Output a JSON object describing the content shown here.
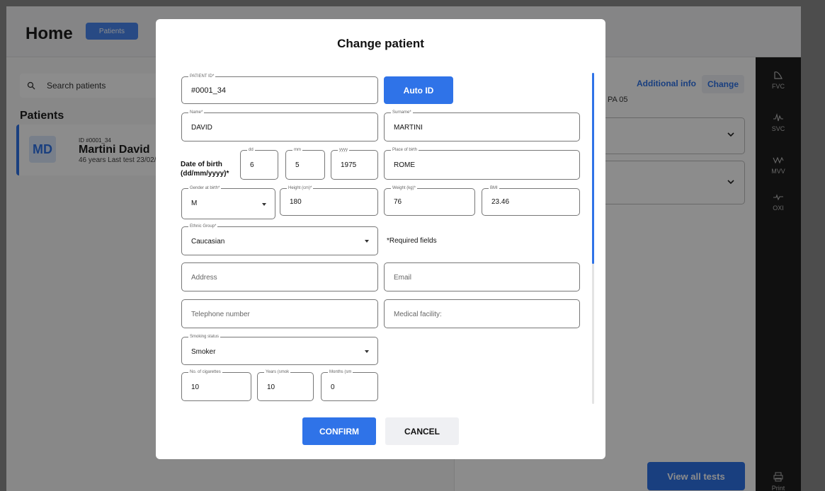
{
  "header": {
    "title": "Home",
    "tab_label": "Patients"
  },
  "sidebar": {
    "search_placeholder": "Search patients",
    "section_title": "Patients",
    "patient": {
      "initials": "MD",
      "id": "ID #0001_34",
      "name": "Martini David",
      "meta": "46 years Last test 23/02/"
    }
  },
  "right_panel": {
    "additional_info": "Additional info",
    "change_label": "Change",
    "pa_value": "PA 05",
    "view_all_label": "View all tests"
  },
  "rail": {
    "items": [
      "FVC",
      "SVC",
      "MVV",
      "OXI",
      "Print"
    ]
  },
  "modal": {
    "title": "Change patient",
    "patient_id": {
      "label": "PATIENT ID*",
      "value": "#0001_34"
    },
    "auto_id_label": "Auto ID",
    "name": {
      "label": "Name*",
      "value": "DAVID"
    },
    "surname": {
      "label": "Surname*",
      "value": "MARTINI"
    },
    "dob_label": "Date of birth (dd/mm/yyyy)*",
    "dd": {
      "label": "dd",
      "value": "6"
    },
    "mm": {
      "label": "mm",
      "value": "5"
    },
    "yyyy": {
      "label": "yyyy",
      "value": "1975"
    },
    "place_of_birth": {
      "label": "Place of birth",
      "value": "ROME"
    },
    "gender": {
      "label": "Gender at birth*",
      "value": "M"
    },
    "height": {
      "label": "Height (cm)*",
      "value": "180"
    },
    "weight": {
      "label": "Weight (kg)*",
      "value": "76"
    },
    "bmi": {
      "label": "BMI",
      "value": "23.46"
    },
    "ethnic_group": {
      "label": "Ethnic Group*",
      "value": "Caucasian"
    },
    "required_note": "*Required fields",
    "address_placeholder": "Address",
    "email_placeholder": "Email",
    "phone_placeholder": "Telephone number",
    "facility_placeholder": "Medical facility:",
    "smoking": {
      "label": "Smoking status",
      "value": "Smoker"
    },
    "cigarettes": {
      "label": "No. of cigarettes",
      "value": "10"
    },
    "years_smoking": {
      "label": "Years (smok",
      "value": "10"
    },
    "months_smoking": {
      "label": "Months (sm",
      "value": "0"
    },
    "confirm_label": "CONFIRM",
    "cancel_label": "CANCEL"
  },
  "colors": {
    "accent": "#2f73e8",
    "rail": "#1e1e1e",
    "overlay": "rgba(0,0,0,0.45)"
  }
}
